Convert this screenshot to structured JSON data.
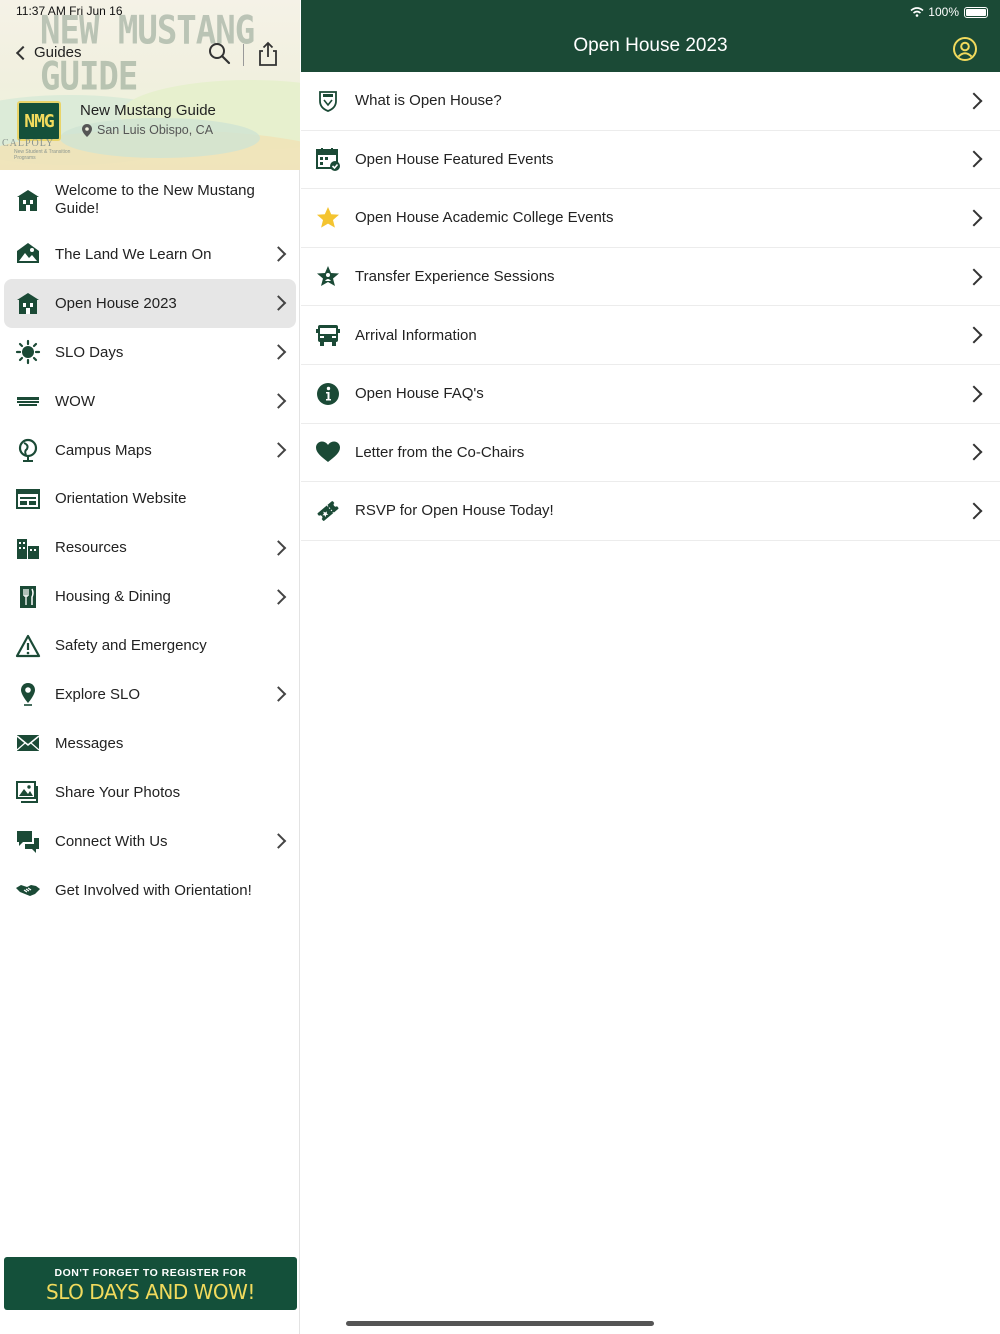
{
  "status": {
    "time": "11:37 AM   Fri Jun 16",
    "battery": "100%"
  },
  "sidebar": {
    "watermark": "NEW MUSTANG GUIDE",
    "back_label": "Guides",
    "logo_text": "NMG",
    "guide_name": "New Mustang Guide",
    "guide_location": "San Luis Obispo, CA",
    "calpoly": "CALPOLY",
    "calpoly_sub": "New Student & Transition Programs",
    "items": [
      {
        "label": "Welcome to the New Mustang Guide!",
        "icon": "building-icon"
      },
      {
        "label": "The Land We Learn On",
        "icon": "landscape-icon"
      },
      {
        "label": "Open House 2023",
        "icon": "building-icon"
      },
      {
        "label": "SLO Days",
        "icon": "sun-icon"
      },
      {
        "label": "WOW",
        "icon": "wow-icon"
      },
      {
        "label": "Campus Maps",
        "icon": "globe-icon"
      },
      {
        "label": "Orientation Website",
        "icon": "website-icon"
      },
      {
        "label": "Resources",
        "icon": "city-icon"
      },
      {
        "label": "Housing & Dining",
        "icon": "dining-icon"
      },
      {
        "label": "Safety and Emergency",
        "icon": "warning-icon"
      },
      {
        "label": "Explore SLO",
        "icon": "map-pin-icon"
      },
      {
        "label": "Messages",
        "icon": "envelope-icon"
      },
      {
        "label": "Share Your Photos",
        "icon": "photos-icon"
      },
      {
        "label": "Connect With Us",
        "icon": "chat-icon"
      },
      {
        "label": "Get Involved with Orientation!",
        "icon": "handshake-icon"
      }
    ],
    "banner": {
      "line1": "DON'T FORGET TO REGISTER FOR",
      "line2": "SLO DAYS AND WOW!"
    }
  },
  "main": {
    "title": "Open House 2023",
    "items": [
      {
        "label": "What is Open House?",
        "icon": "shield-icon"
      },
      {
        "label": "Open House Featured Events",
        "icon": "calendar-icon"
      },
      {
        "label": "Open House Academic College Events",
        "icon": "star-icon"
      },
      {
        "label": "Transfer Experience Sessions",
        "icon": "person-star-icon"
      },
      {
        "label": "Arrival Information",
        "icon": "bus-icon"
      },
      {
        "label": "Open House FAQ's",
        "icon": "info-icon"
      },
      {
        "label": "Letter from the Co-Chairs",
        "icon": "heart-icon"
      },
      {
        "label": "RSVP for Open House Today!",
        "icon": "ticket-icon"
      }
    ]
  },
  "colors": {
    "brand_green": "#1b4a36",
    "accent_gold": "#f1da5d",
    "active_bg": "#e6e6e6",
    "star_yellow": "#f4c430"
  }
}
